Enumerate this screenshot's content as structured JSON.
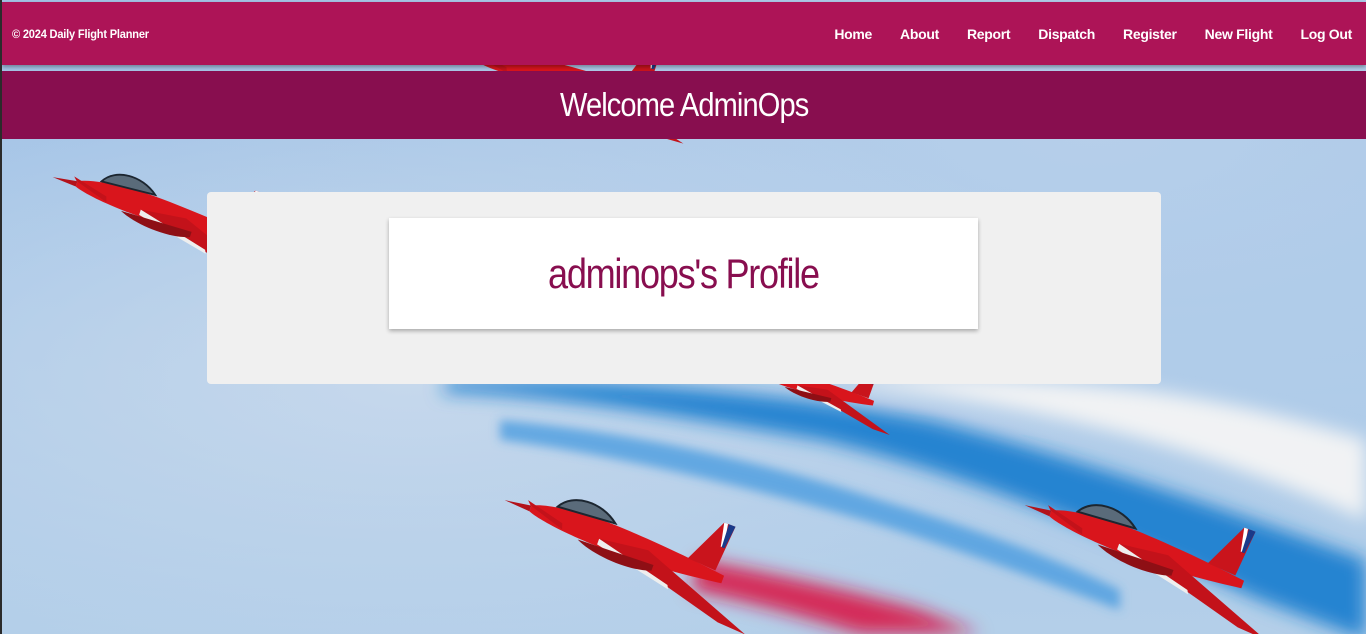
{
  "app": {
    "copyright": "© 2024 Daily Flight Planner"
  },
  "nav": {
    "items": [
      {
        "label": "Home"
      },
      {
        "label": "About"
      },
      {
        "label": "Report"
      },
      {
        "label": "Dispatch"
      },
      {
        "label": "Register"
      },
      {
        "label": "New Flight"
      },
      {
        "label": "Log Out"
      }
    ]
  },
  "welcome": {
    "title": "Welcome AdminOps"
  },
  "profile": {
    "title": "adminops's Profile"
  },
  "theme": {
    "navbar_color": "#ad1457",
    "banner_color": "#880e4f",
    "panel_color": "#f0f0f0",
    "card_color": "#ffffff",
    "title_color": "#880e4f"
  },
  "background": {
    "image": "red-jet-formation-icon"
  }
}
